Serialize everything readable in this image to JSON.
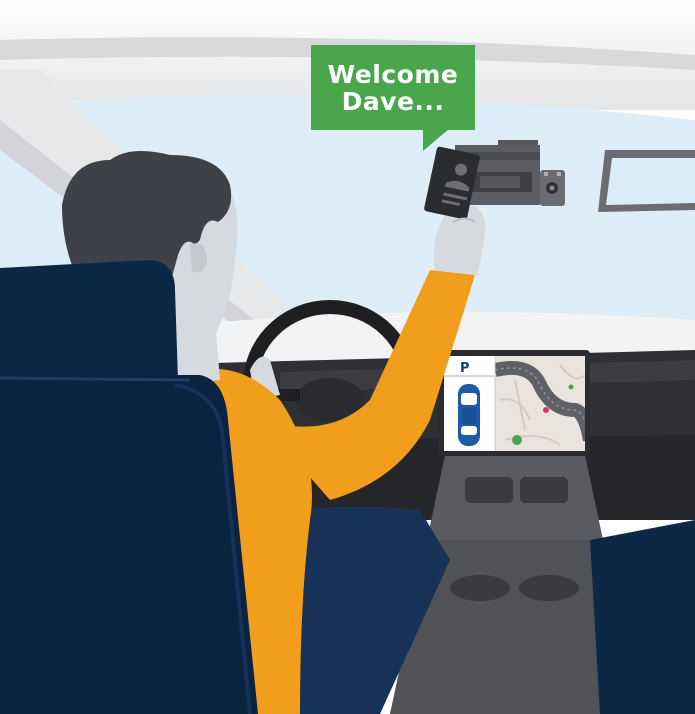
{
  "speech_bubble": {
    "line1": "Welcome",
    "line2": "Dave..."
  },
  "infotainment": {
    "gear_indicator": "P"
  },
  "colors": {
    "bubble_green": "#4aa64b",
    "sky": "#deeef9",
    "shirt_orange": "#f09e1c",
    "seat_navy": "#0d2747",
    "hair": "#3f4149",
    "dash_dark": "#2f3033",
    "screen_map": "#e9e4dd",
    "car_icon_blue": "#1e5aa8"
  },
  "icons": [
    "driver-card-icon",
    "car-top-view-icon",
    "steering-wheel-icon",
    "dashcam-icon",
    "map-pin-icon"
  ]
}
